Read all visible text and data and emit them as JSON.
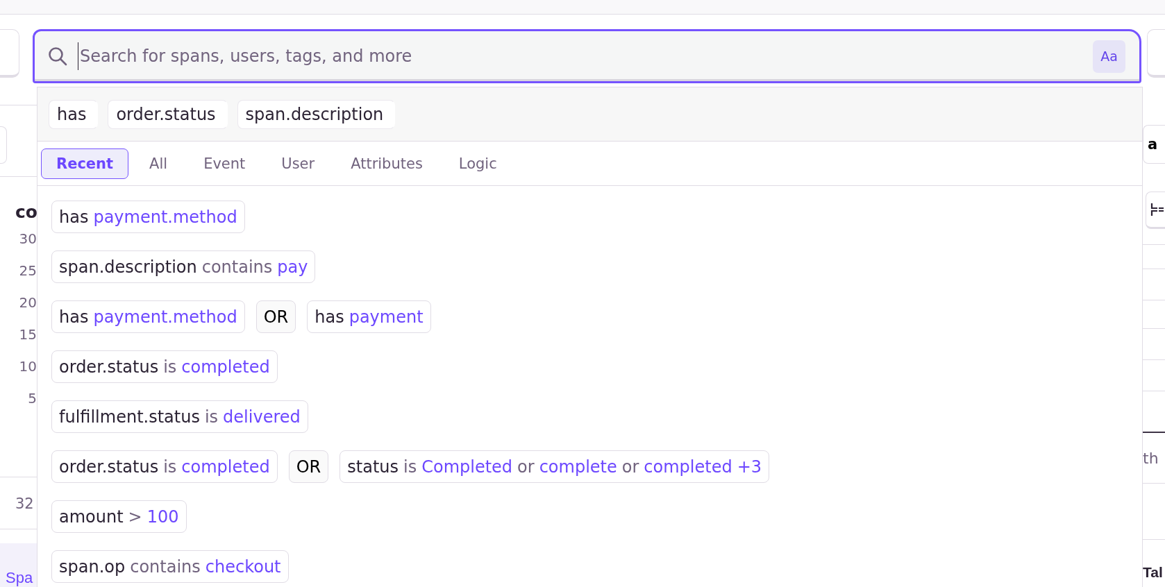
{
  "page_left": {
    "heading": "co",
    "axis_labels": [
      "30",
      "25",
      "20",
      "15",
      "10",
      "5"
    ],
    "count": "32",
    "tab": "Spa"
  },
  "page_right": {
    "button": "a",
    "cell": "th",
    "heading": "Tal"
  },
  "search": {
    "placeholder": "Search for spans, users, tags, and more",
    "case_toggle": "Aa"
  },
  "suggestions": {
    "keys": [
      "has",
      "order.status",
      "span.description"
    ],
    "tabs": [
      {
        "label": "Recent",
        "selected": true
      },
      {
        "label": "All",
        "selected": false
      },
      {
        "label": "Event",
        "selected": false
      },
      {
        "label": "User",
        "selected": false
      },
      {
        "label": "Attributes",
        "selected": false
      },
      {
        "label": "Logic",
        "selected": false
      }
    ],
    "recent": [
      {
        "parts": [
          {
            "kind": "filter",
            "tokens": [
              {
                "kind": "text",
                "text": "has"
              },
              {
                "kind": "value",
                "text": "payment.method"
              }
            ]
          }
        ]
      },
      {
        "parts": [
          {
            "kind": "filter",
            "tokens": [
              {
                "kind": "text",
                "text": "span.description"
              },
              {
                "kind": "operator",
                "text": "contains"
              },
              {
                "kind": "value",
                "text": "pay"
              }
            ]
          }
        ]
      },
      {
        "parts": [
          {
            "kind": "filter",
            "tokens": [
              {
                "kind": "text",
                "text": "has"
              },
              {
                "kind": "value",
                "text": "payment.method"
              }
            ]
          },
          {
            "kind": "logic",
            "text": "OR"
          },
          {
            "kind": "filter",
            "tokens": [
              {
                "kind": "text",
                "text": "has"
              },
              {
                "kind": "value",
                "text": "payment"
              }
            ]
          }
        ]
      },
      {
        "parts": [
          {
            "kind": "filter",
            "tokens": [
              {
                "kind": "text",
                "text": "order.status"
              },
              {
                "kind": "operator",
                "text": "is"
              },
              {
                "kind": "value",
                "text": "completed"
              }
            ]
          }
        ]
      },
      {
        "parts": [
          {
            "kind": "filter",
            "tokens": [
              {
                "kind": "text",
                "text": "fulfillment.status"
              },
              {
                "kind": "operator",
                "text": "is"
              },
              {
                "kind": "value",
                "text": "delivered"
              }
            ]
          }
        ]
      },
      {
        "parts": [
          {
            "kind": "filter",
            "tokens": [
              {
                "kind": "text",
                "text": "order.status"
              },
              {
                "kind": "operator",
                "text": "is"
              },
              {
                "kind": "value",
                "text": "completed"
              }
            ]
          },
          {
            "kind": "logic",
            "text": "OR"
          },
          {
            "kind": "filter",
            "tokens": [
              {
                "kind": "text",
                "text": "status"
              },
              {
                "kind": "operator",
                "text": "is"
              },
              {
                "kind": "value",
                "text": "Completed"
              },
              {
                "kind": "operator",
                "text": "or"
              },
              {
                "kind": "value",
                "text": "complete"
              },
              {
                "kind": "operator",
                "text": "or"
              },
              {
                "kind": "value",
                "text": "completed"
              },
              {
                "kind": "value",
                "text": "+3"
              }
            ]
          }
        ]
      },
      {
        "parts": [
          {
            "kind": "filter",
            "tokens": [
              {
                "kind": "text",
                "text": "amount"
              },
              {
                "kind": "operator",
                "text": ">"
              },
              {
                "kind": "value",
                "text": "100"
              }
            ]
          }
        ]
      },
      {
        "parts": [
          {
            "kind": "filter",
            "tokens": [
              {
                "kind": "text",
                "text": "span.op"
              },
              {
                "kind": "operator",
                "text": "contains"
              },
              {
                "kind": "value",
                "text": "checkout"
              }
            ]
          }
        ]
      }
    ]
  }
}
